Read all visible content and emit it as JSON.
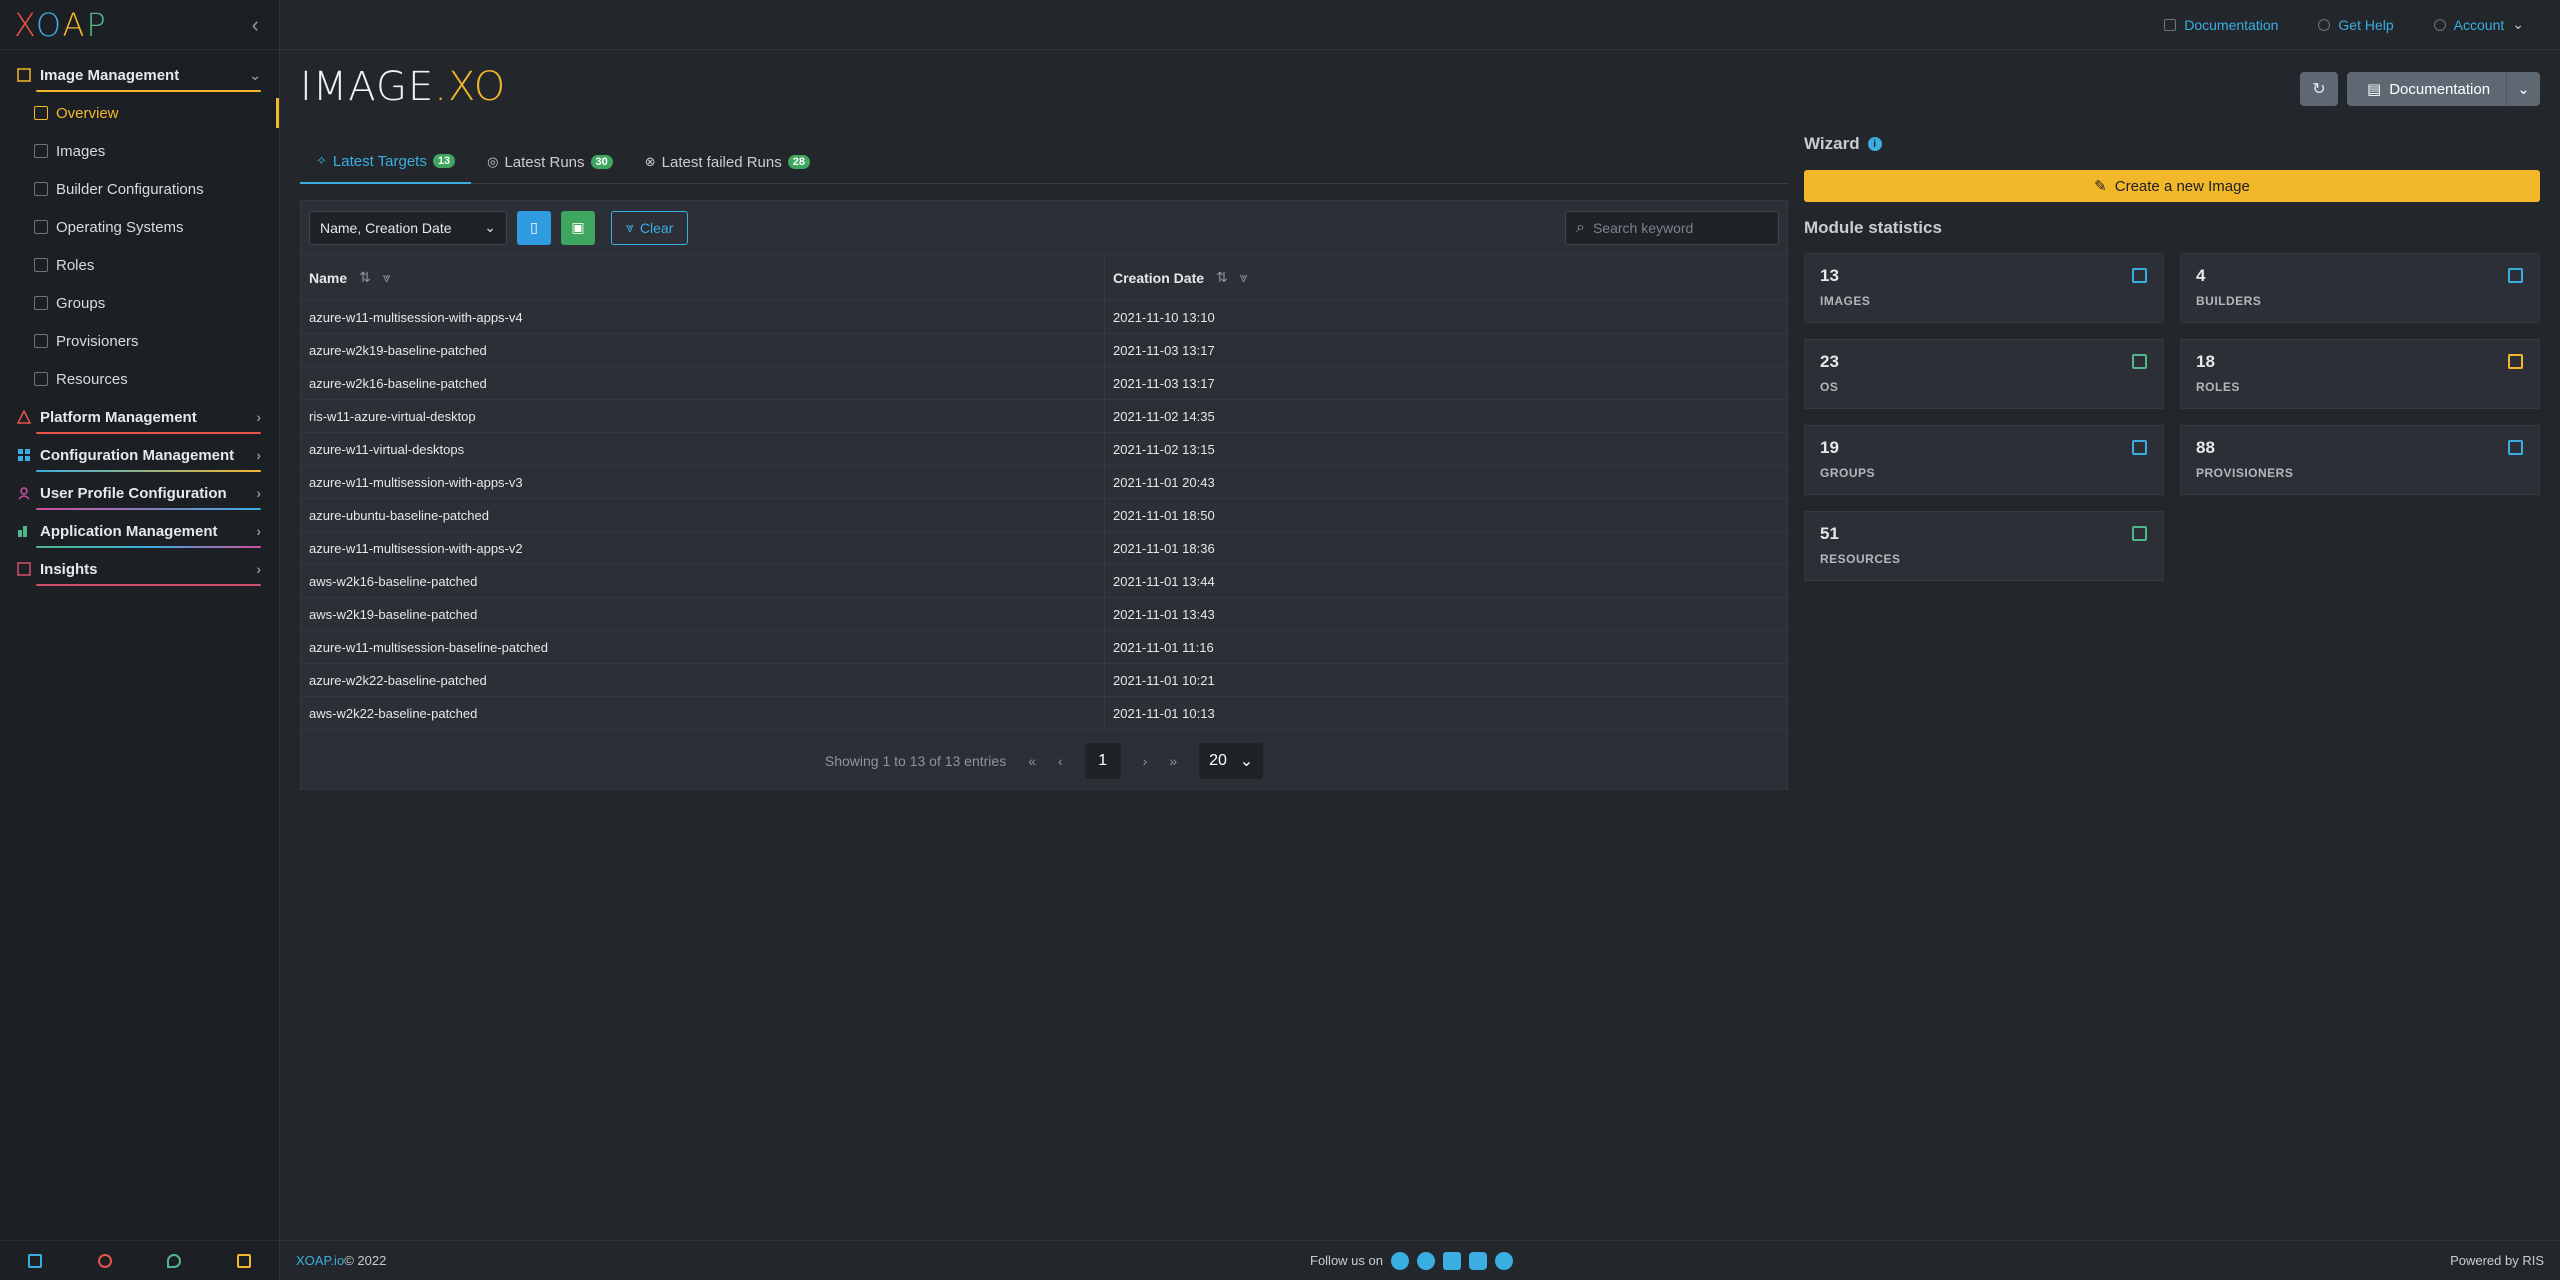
{
  "app": {
    "logo": [
      "X",
      "O",
      "A",
      "P"
    ],
    "collapse_icon": "chevron-left-icon"
  },
  "sidebar": {
    "groups": [
      {
        "label": "Image Management",
        "color": "#f3b72a",
        "expanded": true,
        "items": [
          {
            "label": "Overview",
            "active": true
          },
          {
            "label": "Images"
          },
          {
            "label": "Builder Configurations"
          },
          {
            "label": "Operating Systems"
          },
          {
            "label": "Roles"
          },
          {
            "label": "Groups"
          },
          {
            "label": "Provisioners"
          },
          {
            "label": "Resources"
          }
        ]
      },
      {
        "label": "Platform Management",
        "color": "#e8534a"
      },
      {
        "label": "Configuration Management",
        "color": "#3aaee0"
      },
      {
        "label": "User Profile Configuration",
        "color": "#d14fa0"
      },
      {
        "label": "Application Management",
        "color": "#52b788"
      },
      {
        "label": "Insights",
        "color": "#d14f6a"
      }
    ]
  },
  "topbar": {
    "documentation": "Documentation",
    "help": "Get Help",
    "account": "Account"
  },
  "brand": {
    "main": "IMAGE",
    "suffix": ".XO"
  },
  "header_buttons": {
    "documentation": "Documentation"
  },
  "tabs": [
    {
      "label": "Latest Targets",
      "count": "13",
      "active": true
    },
    {
      "label": "Latest Runs",
      "count": "30"
    },
    {
      "label": "Latest failed Runs",
      "count": "28"
    }
  ],
  "table": {
    "column_select": "Name, Creation Date",
    "clear_label": "Clear",
    "search_placeholder": "Search keyword",
    "headers": {
      "name": "Name",
      "date": "Creation Date"
    },
    "rows": [
      {
        "name": "azure-w11-multisession-with-apps-v4",
        "date": "2021-11-10 13:10"
      },
      {
        "name": "azure-w2k19-baseline-patched",
        "date": "2021-11-03 13:17"
      },
      {
        "name": "azure-w2k16-baseline-patched",
        "date": "2021-11-03 13:17"
      },
      {
        "name": "ris-w11-azure-virtual-desktop",
        "date": "2021-11-02 14:35"
      },
      {
        "name": "azure-w11-virtual-desktops",
        "date": "2021-11-02 13:15"
      },
      {
        "name": "azure-w11-multisession-with-apps-v3",
        "date": "2021-11-01 20:43"
      },
      {
        "name": "azure-ubuntu-baseline-patched",
        "date": "2021-11-01 18:50"
      },
      {
        "name": "azure-w11-multisession-with-apps-v2",
        "date": "2021-11-01 18:36"
      },
      {
        "name": "aws-w2k16-baseline-patched",
        "date": "2021-11-01 13:44"
      },
      {
        "name": "aws-w2k19-baseline-patched",
        "date": "2021-11-01 13:43"
      },
      {
        "name": "azure-w11-multisession-baseline-patched",
        "date": "2021-11-01 11:16"
      },
      {
        "name": "azure-w2k22-baseline-patched",
        "date": "2021-11-01 10:21"
      },
      {
        "name": "aws-w2k22-baseline-patched",
        "date": "2021-11-01 10:13"
      }
    ],
    "pager": {
      "summary": "Showing 1 to 13 of 13 entries",
      "current_page": "1",
      "page_size": "20"
    }
  },
  "wizard": {
    "title": "Wizard",
    "create_label": "Create a new Image"
  },
  "stats": {
    "title": "Module statistics",
    "items": [
      {
        "value": "13",
        "label": "IMAGES",
        "color": "#3aaee0"
      },
      {
        "value": "4",
        "label": "BUILDERS",
        "color": "#3aaee0"
      },
      {
        "value": "23",
        "label": "OS",
        "color": "#52b788"
      },
      {
        "value": "18",
        "label": "ROLES",
        "color": "#f3b72a"
      },
      {
        "value": "19",
        "label": "GROUPS",
        "color": "#3aaee0"
      },
      {
        "value": "88",
        "label": "PROVISIONERS",
        "color": "#3aaee0"
      },
      {
        "value": "51",
        "label": "RESOURCES",
        "color": "#52b788"
      }
    ]
  },
  "footer": {
    "brand_link": "XOAP.io",
    "copyright": " © 2022",
    "follow": "Follow us on",
    "powered": "Powered by RIS"
  }
}
